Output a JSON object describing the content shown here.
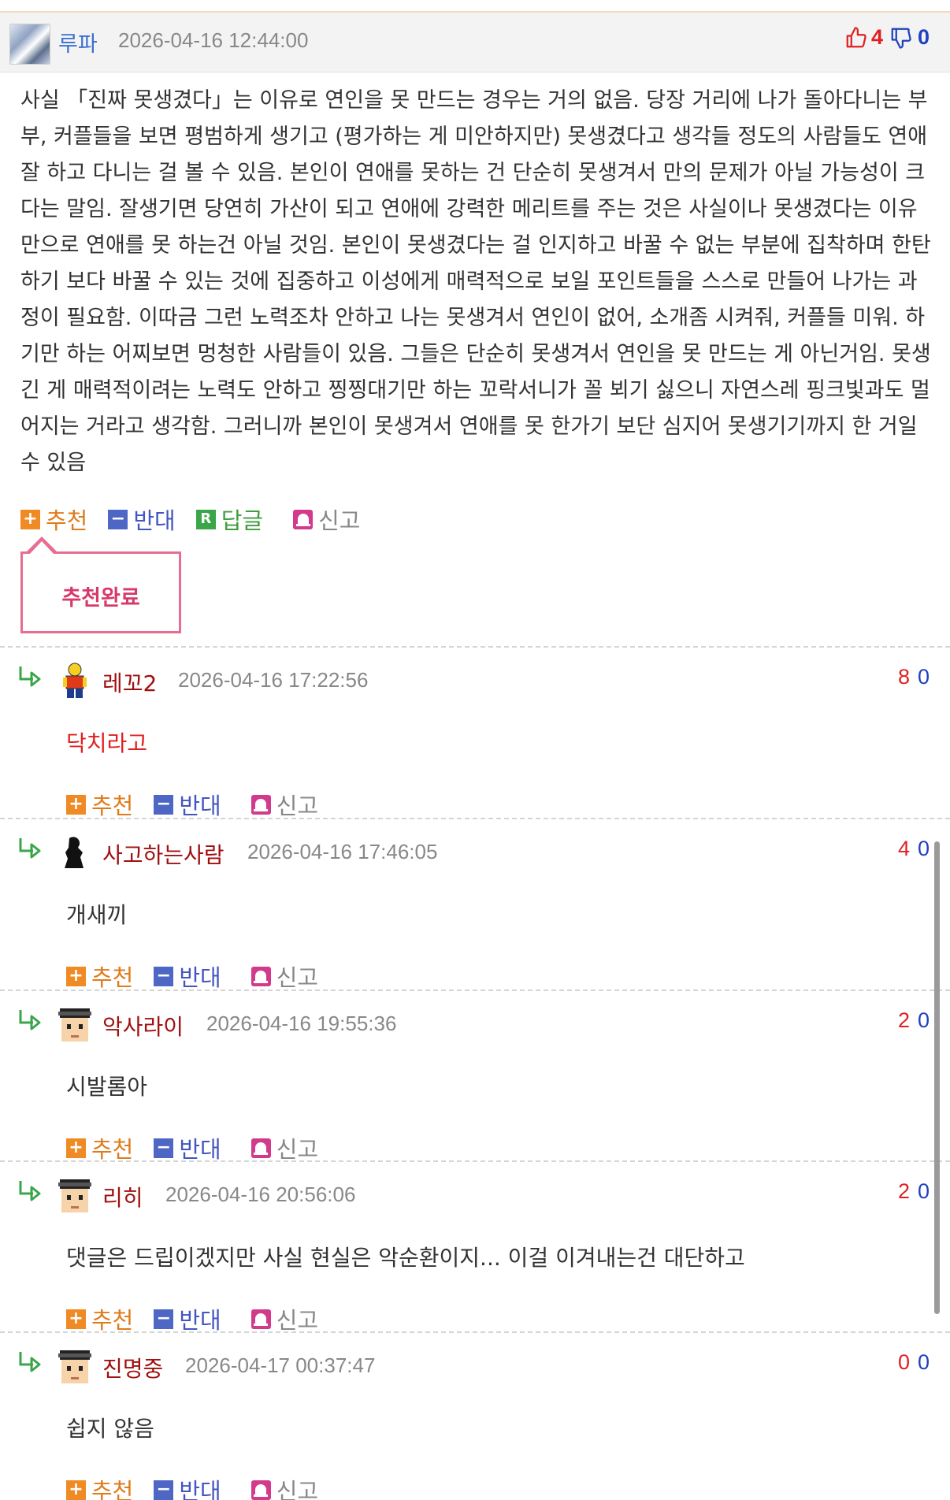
{
  "post": {
    "author": "루파",
    "date": "2026-04-16 12:44:00",
    "up_votes": "4",
    "down_votes": "0",
    "body": "사실 「진짜 못생겼다」는 이유로 연인을 못 만드는 경우는 거의 없음. 당장 거리에 나가 돌아다니는 부부, 커플들을 보면 평범하게 생기고 (평가하는 게 미안하지만) 못생겼다고 생각들 정도의 사람들도 연애 잘 하고 다니는 걸 볼 수 있음. 본인이 연애를 못하는 건 단순히 못생겨서 만의 문제가 아닐 가능성이 크다는 말임. 잘생기면 당연히 가산이 되고 연애에 강력한 메리트를 주는 것은 사실이나 못생겼다는 이유 만으로 연애를 못 하는건 아닐 것임. 본인이 못생겼다는 걸 인지하고 바꿀 수 없는 부분에 집착하며 한탄하기 보다 바꿀 수 있는 것에 집중하고 이성에게 매력적으로 보일 포인트들을 스스로 만들어 나가는 과정이 필요함. 이따금 그런 노력조차 안하고 나는 못생겨서 연인이 없어, 소개좀 시켜줘, 커플들 미워. 하기만 하는 어찌보면 멍청한 사람들이 있음. 그들은 단순히 못생겨서 연인을 못 만드는 게 아닌거임. 못생긴 게 매력적이려는 노력도 안하고 찡찡대기만 하는 꼬락서니가 꼴 뵈기 싫으니 자연스레 핑크빛과도 멀어지는 거라고 생각함. 그러니까 본인이 못생겨서 연애를 못 한가기 보단 심지어 못생기기까지 한 거일 수 있음"
  },
  "actions": {
    "recommend": "추천",
    "oppose": "반대",
    "reply": "답글",
    "report": "신고",
    "reply_badge": "R"
  },
  "tooltip": "추천완료",
  "comments": [
    {
      "author": "레꼬2",
      "date": "2026-04-16 17:22:56",
      "up": "8",
      "down": "0",
      "text": "닥치라고",
      "avatar": "lego-figure-avatar"
    },
    {
      "author": "사고하는사람",
      "date": "2026-04-16 17:46:05",
      "up": "4",
      "down": "0",
      "text": "개새끼",
      "avatar": "thinker-avatar"
    },
    {
      "author": "악사라이",
      "date": "2026-04-16 19:55:36",
      "up": "2",
      "down": "0",
      "text": "시발롬아",
      "avatar": "pixel-face-avatar"
    },
    {
      "author": "리히",
      "date": "2026-04-16 20:56:06",
      "up": "2",
      "down": "0",
      "text": "댓글은 드립이겠지만 사실 현실은 악순환이지... 이걸 이겨내는건 대단하고",
      "avatar": "pixel-face-avatar"
    },
    {
      "author": "진명중",
      "date": "2026-04-17 00:37:47",
      "up": "0",
      "down": "0",
      "text": "쉽지 않음",
      "avatar": "pixel-face-avatar"
    }
  ],
  "colors": {
    "recommend": "#f08a24",
    "oppose": "#4f67c4",
    "reply": "#3aa64a",
    "report": "#d23a8b",
    "tooltip_border": "#e76e91",
    "up": "#e02020",
    "down": "#2040c0",
    "comment_author": "#a01010"
  }
}
